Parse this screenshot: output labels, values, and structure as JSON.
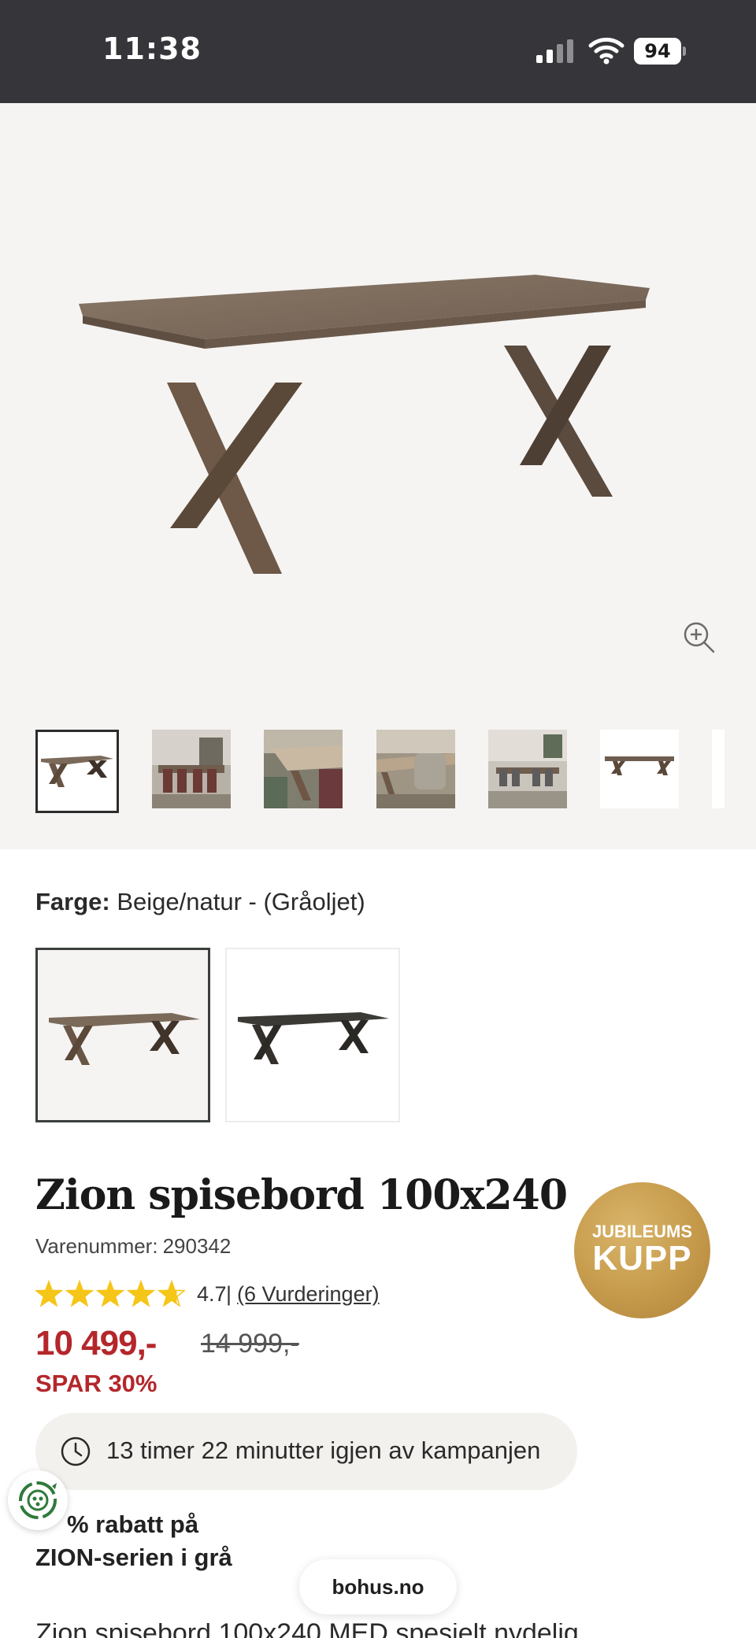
{
  "status_bar": {
    "time": "11:38",
    "battery": "94"
  },
  "gallery": {
    "thumbnail_count": 7
  },
  "color": {
    "label": "Farge:",
    "value": "Beige/natur - (Gråoljet)"
  },
  "product": {
    "title": "Zion spisebord 100x240",
    "sku_label": "Varenummer:",
    "sku": "290342",
    "badge_line1": "JUBILEUMS",
    "badge_line2": "KUPP"
  },
  "rating": {
    "value": "4.7",
    "sep": "|",
    "reviews": "(6 Vurderinger)",
    "score": 4.7,
    "max": 5
  },
  "price": {
    "current": "10 499,-",
    "original": "14 999,-",
    "save": "SPAR 30%"
  },
  "campaign": {
    "timer": "13 timer 22 minutter igjen av kampanjen"
  },
  "promo": {
    "line1": "% rabatt på",
    "line2": "ZION-serien i grå"
  },
  "browser": {
    "url": "bohus.no"
  },
  "description_peek": "Zion spisebord 100x240 MED spesielt nydelig",
  "colors": {
    "price_red": "#b4272b",
    "badge_gold": "#c69a4b",
    "status_bar": "#363539"
  }
}
